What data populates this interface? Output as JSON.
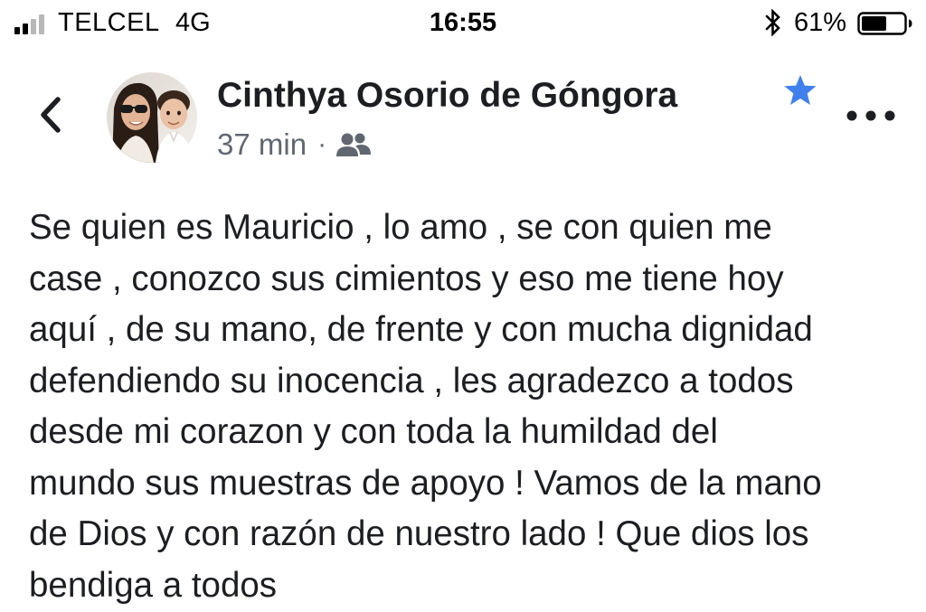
{
  "status_bar": {
    "carrier": "TELCEL",
    "network": "4G",
    "time": "16:55",
    "battery_percent": "61%",
    "battery_level": 0.61,
    "signal_bars_active": 2,
    "signal_bars_total": 4,
    "icons": [
      "signal-icon",
      "bluetooth-icon",
      "battery-icon"
    ]
  },
  "post": {
    "author": "Cinthya Osorio de Góngora",
    "time": "37 min",
    "separator": "·",
    "audience_icon": "friends-icon",
    "favorite_icon": "star-icon",
    "more_icon": "more-options-icon",
    "back_icon": "back-chevron-icon",
    "body_lines": [
      "Se quien es Mauricio , lo amo , se con quien me",
      "case , conozco sus cimientos y eso me tiene hoy",
      "aquí , de su mano, de frente y con mucha dignidad",
      "defendiendo su inocencia , les agradezco a todos",
      "desde mi corazon y con toda la humildad del",
      "mundo sus muestras de apoyo ! Vamos de la mano",
      "de Dios y con razón de nuestro lado ! Que dios los",
      "bendiga a todos"
    ]
  },
  "colors": {
    "accent_blue": "#4080ec",
    "text_primary": "#1c1e21",
    "text_secondary": "#616770",
    "icon_gray": "#606770"
  }
}
